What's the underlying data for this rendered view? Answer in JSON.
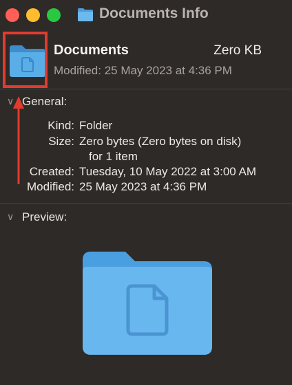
{
  "window": {
    "title": "Documents Info"
  },
  "header": {
    "name": "Documents",
    "size": "Zero KB",
    "modified": "Modified: 25 May 2023 at 4:36 PM"
  },
  "general": {
    "label": "General:",
    "rows": [
      {
        "label": "Kind:",
        "value": "Folder"
      },
      {
        "label": "Size:",
        "value": "Zero bytes (Zero bytes on disk)",
        "value2": "for 1 item"
      },
      {
        "label": "Created:",
        "value": "Tuesday, 10 May 2022 at 3:00 AM"
      },
      {
        "label": "Modified:",
        "value": "25 May 2023 at 4:36 PM"
      }
    ]
  },
  "preview": {
    "label": "Preview:"
  },
  "icons": {
    "title": "folder-icon",
    "header": "document-folder-icon",
    "preview": "document-folder-icon",
    "section_toggle": "chevron-down-icon"
  },
  "colors": {
    "close": "#fe5f57",
    "minimize": "#febc2e",
    "zoom": "#28c840",
    "annotation": "#e23b2e",
    "folder": "#5aaee8"
  }
}
